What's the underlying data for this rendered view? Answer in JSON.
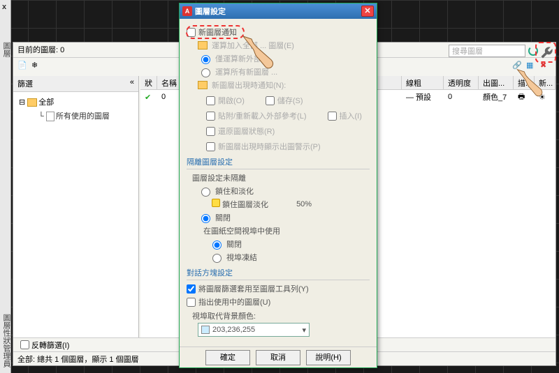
{
  "vbar": {
    "close": "x",
    "title": "圖層",
    "title2": "圖層性狀管理員"
  },
  "panel": {
    "current_layer_label": "目前的圖層: 0",
    "search_placeholder": "搜尋圖層"
  },
  "left": {
    "filter_title": "篩選",
    "all": "全部",
    "used": "所有使用的圖層",
    "invert": "反轉篩選(I)"
  },
  "columns": {
    "status": "狀",
    "name": "名稱",
    "line": "線粗",
    "trans": "透明度",
    "plot": "出圖...",
    "desc": "描...",
    "new": "新..."
  },
  "row": {
    "name": "0",
    "line": "— 預設",
    "trans": "0",
    "plot": "顏色_7"
  },
  "status_text": "全部: 總共 1 個圖層，顯示 1 個圖層",
  "dialog": {
    "title": "圖層設定",
    "new_notify": "新圖層通知",
    "eval_add": "運算加入全部 ... 圖層(E)",
    "eval_new": "僅運算新外部 ...",
    "eval_all": "運算所有新圖層 ...",
    "notify_when": "新圖層出現時通知(N):",
    "open": "開啟(O)",
    "save": "儲存(S)",
    "attach": "貼附/重新載入外部參考(L)",
    "insert": "插入(I)",
    "restore": "還原圖層狀態(R)",
    "show_plot": "新圖層出現時顯示出圖警示(P)",
    "sec2": "隔離圖層設定",
    "not_iso": "圖層設定未隔離",
    "lockfade": "鎖住和淡化",
    "lock_amount": "鎖住圖層淡化",
    "fifty": "50%",
    "off": "關閉",
    "paper": "在圖紙空間視埠中使用",
    "r_off": "關閉",
    "r_freeze": "視埠凍結",
    "sec3": "對話方塊設定",
    "apply_toolbar": "將圖層篩選套用至圖層工具列(Y)",
    "indicate": "指出使用中的圖層(U)",
    "bgcolor_label": "視埠取代背景顏色:",
    "bgcolor": "203,236,255",
    "ok": "確定",
    "cancel": "取消",
    "help": "說明(H)"
  }
}
